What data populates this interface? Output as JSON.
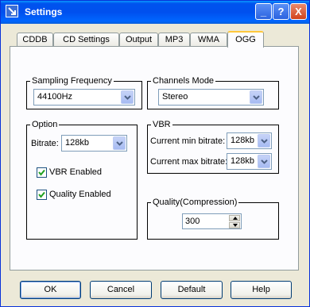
{
  "window": {
    "title": "Settings",
    "minimize": "_",
    "help": "?",
    "close": "X"
  },
  "tabs": [
    {
      "label": "CDDB"
    },
    {
      "label": "CD Settings"
    },
    {
      "label": "Output"
    },
    {
      "label": "MP3"
    },
    {
      "label": "WMA"
    },
    {
      "label": "OGG",
      "active": true
    }
  ],
  "sampling": {
    "legend": "Sampling Frequency",
    "value": "44100Hz"
  },
  "channels": {
    "legend": "Channels Mode",
    "value": "Stereo"
  },
  "option": {
    "legend": "Option",
    "bitrate_label": "Bitrate:",
    "bitrate_value": "128kb",
    "vbr_enabled_label": "VBR Enabled",
    "vbr_enabled": true,
    "quality_enabled_label": "Quality Enabled",
    "quality_enabled": true
  },
  "vbr": {
    "legend": "VBR",
    "min_label": "Current min bitrate:",
    "min_value": "128kb",
    "max_label": "Current max bitrate:",
    "max_value": "128kb"
  },
  "quality": {
    "legend": "Quality(Compression)",
    "value": "300"
  },
  "buttons": {
    "ok": "OK",
    "cancel": "Cancel",
    "default": "Default",
    "help": "Help"
  },
  "colors": {
    "titlebar": "#0054e3",
    "face": "#ece9d8",
    "active_tab_accent": "#ffc83c"
  }
}
